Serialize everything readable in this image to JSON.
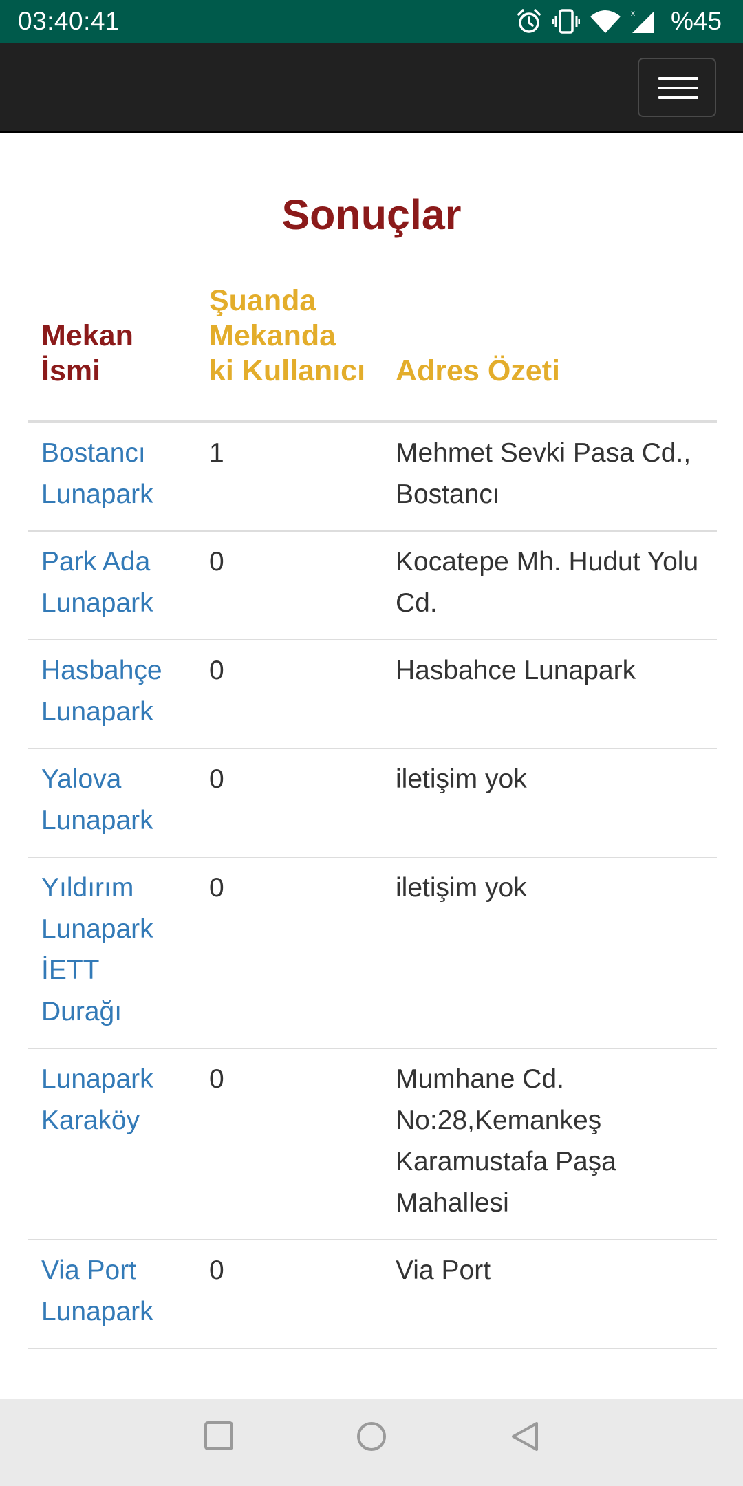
{
  "status_bar": {
    "time": "03:40:41",
    "battery": "%45",
    "icons": [
      "alarm-icon",
      "vibrate-icon",
      "wifi-icon",
      "signal-icon"
    ]
  },
  "navbar": {
    "menu_icon": "hamburger-menu-icon"
  },
  "page": {
    "title": "Sonuçlar"
  },
  "table": {
    "headers": {
      "name": "Mekan İsmi",
      "count": "Şuanda Mekanda ki Kullanıcı",
      "address": "Adres Özeti"
    },
    "rows": [
      {
        "name": "Bostancı Lunapark",
        "count": "1",
        "address": "Mehmet Sevki Pasa Cd., Bostancı"
      },
      {
        "name": "Park Ada Lunapark",
        "count": "0",
        "address": "Kocatepe Mh. Hudut Yolu Cd."
      },
      {
        "name": "Hasbahçe Lunapark",
        "count": "0",
        "address": "Hasbahce Lunapark"
      },
      {
        "name": "Yalova Lunapark",
        "count": "0",
        "address": "iletişim yok"
      },
      {
        "name": "Yıldırım Lunapark İETT Durağı",
        "count": "0",
        "address": "iletişim yok"
      },
      {
        "name": "Lunapark Karaköy",
        "count": "0",
        "address": "Mumhane Cd. No:28,Kemankeş Karamustafa Paşa Mahallesi"
      },
      {
        "name": "Via Port Lunapark",
        "count": "0",
        "address": "Via Port"
      }
    ]
  },
  "colors": {
    "status_bar": "#005a4b",
    "navbar": "#212121",
    "title": "#8b1a1a",
    "header_gold": "#e3ad2b",
    "link": "#337ab7"
  },
  "system_nav": {
    "buttons": [
      "recents-square-icon",
      "home-circle-icon",
      "back-triangle-icon"
    ]
  }
}
